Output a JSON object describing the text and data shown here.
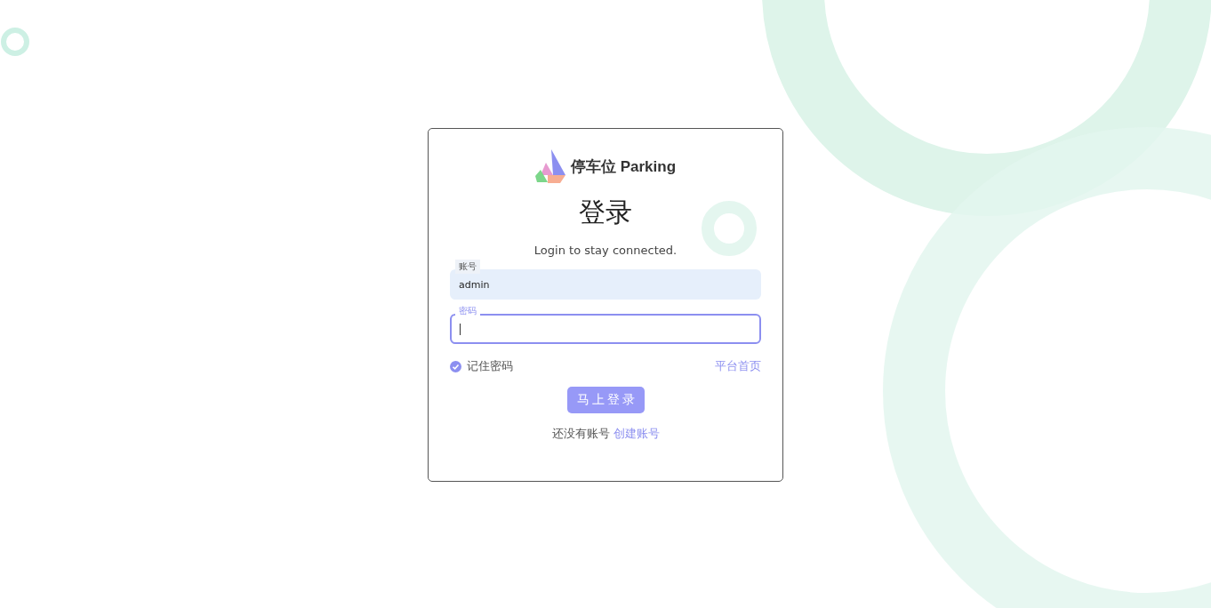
{
  "brand": {
    "name": "停车位 Parking"
  },
  "title": "登录",
  "subtitle": "Login to stay connected.",
  "fields": [
    {
      "label": "账号",
      "value": "admin",
      "focused": false,
      "filled": true
    },
    {
      "label": "密码",
      "focused": true,
      "filled": false
    }
  ],
  "remember": {
    "label": "记住密码",
    "checked": true
  },
  "home_link": "平台首页",
  "submit": "马上登录",
  "signup": {
    "prompt": "还没有账号",
    "link": "创建账号"
  }
}
